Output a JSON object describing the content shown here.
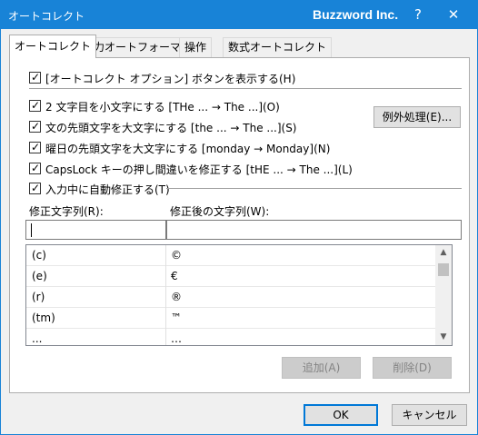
{
  "window": {
    "title": "オートコレクト",
    "brand": "Buzzword Inc.",
    "help": "?",
    "close": "✕"
  },
  "tabs": [
    {
      "label": "オートコレクト",
      "active": true
    },
    {
      "label": "入力オートフォーマット",
      "active": false
    },
    {
      "label": "操作",
      "active": false
    },
    {
      "label": "数式オートコレクト",
      "active": false
    }
  ],
  "options": {
    "show_buttons": {
      "label": "[オートコレクト オプション] ボタンを表示する(H)",
      "checked": true
    },
    "two_initial_caps": {
      "label": "2 文字目を小文字にする [THe ... → The ...](O)",
      "checked": true
    },
    "capitalize_sentence": {
      "label": "文の先頭文字を大文字にする [the ... → The ...](S)",
      "checked": true
    },
    "capitalize_days": {
      "label": "曜日の先頭文字を大文字にする [monday → Monday](N)",
      "checked": true
    },
    "capslock": {
      "label": "CapsLock キーの押し間違いを修正する [tHE ... → The ...](L)",
      "checked": true
    },
    "replace_as_type": {
      "label": "入力中に自動修正する(T)",
      "checked": true
    }
  },
  "exceptions_button": "例外処理(E)...",
  "replace": {
    "label": "修正文字列(R):",
    "value": ""
  },
  "with": {
    "label": "修正後の文字列(W):",
    "value": ""
  },
  "entries": [
    {
      "from": "(c)",
      "to": "©"
    },
    {
      "from": "(e)",
      "to": "€"
    },
    {
      "from": "(r)",
      "to": "®"
    },
    {
      "from": "(tm)",
      "to": "™"
    },
    {
      "from": "...",
      "to": "…"
    }
  ],
  "add_button": "追加(A)",
  "delete_button": "削除(D)",
  "ok_button": "OK",
  "cancel_button": "キャンセル",
  "check_mark": "✓",
  "scroll_up_glyph": "▲",
  "scroll_down_glyph": "▼"
}
